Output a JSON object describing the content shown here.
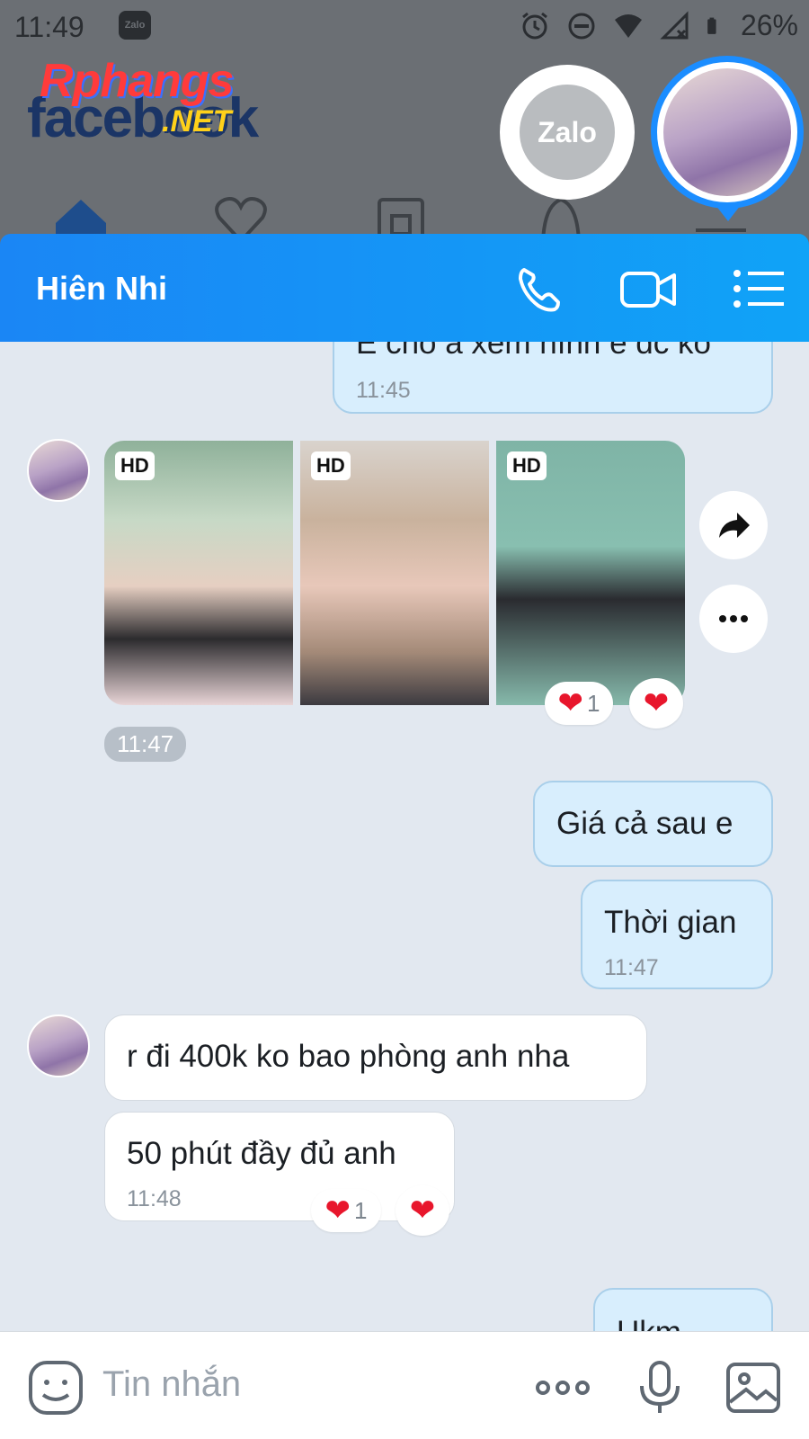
{
  "status_bar": {
    "time": "11:49",
    "notification_app": "Zalo",
    "battery": "26%"
  },
  "background_app": {
    "watermark_main": "Rphangs",
    "watermark_suffix": ".NET",
    "watermark_back": "facebook"
  },
  "chat_head": {
    "app_label": "Zalo"
  },
  "header": {
    "contact_name": "Hiên Nhi"
  },
  "messages": [
    {
      "id": "m1",
      "sender": "me",
      "text": "E cho a xem hình e dc ko",
      "time": "11:45"
    },
    {
      "id": "m2",
      "sender": "them",
      "type": "photos",
      "badges": [
        "HD",
        "HD",
        "HD"
      ],
      "time": "11:47",
      "reaction_count": "1"
    },
    {
      "id": "m3",
      "sender": "me",
      "text": "Giá cả sau e"
    },
    {
      "id": "m4",
      "sender": "me",
      "text": "Thời gian",
      "time": "11:47"
    },
    {
      "id": "m5",
      "sender": "them",
      "text": "r đi 400k ko bao phòng anh nha"
    },
    {
      "id": "m6",
      "sender": "them",
      "text": "50 phút đầy đủ anh",
      "time": "11:48",
      "reaction_count": "1"
    },
    {
      "id": "m7",
      "sender": "me",
      "text": "Ukm"
    }
  ],
  "input": {
    "placeholder": "Tin nhắn"
  },
  "colors": {
    "header_start": "#1a86f5",
    "header_end": "#10a3f7",
    "my_bubble": "#d8eefd",
    "their_bubble": "#ffffff",
    "heart": "#e8162c",
    "chat_bg": "#e2e8f0"
  },
  "icons": {
    "header": [
      "phone-icon",
      "video-call-icon",
      "list-menu-icon"
    ],
    "input": [
      "sticker-icon",
      "more-icon",
      "microphone-icon",
      "image-icon"
    ],
    "photo_actions": [
      "share-icon",
      "more-options-icon"
    ]
  }
}
